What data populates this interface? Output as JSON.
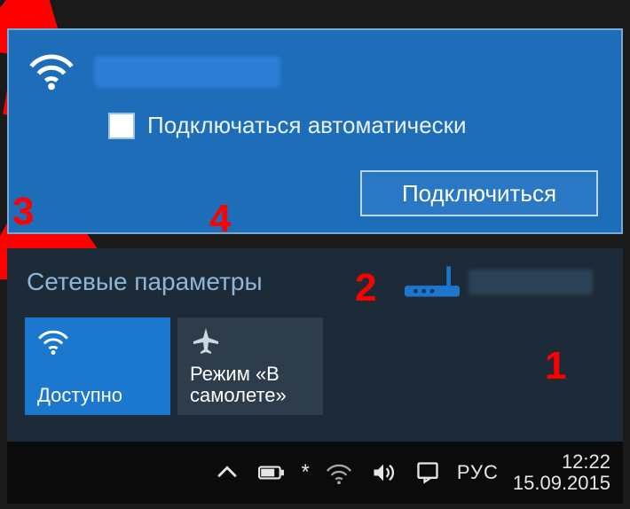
{
  "top_panel": {
    "ssid": "(blurred)",
    "auto_connect_label": "Подключаться автоматически",
    "connect_button": "Подключиться"
  },
  "bottom_panel": {
    "settings_title": "Сетевые параметры",
    "tiles": {
      "wifi_label": "Доступно",
      "airplane_label": "Режим «В самолете»"
    }
  },
  "taskbar": {
    "language": "РУС",
    "time": "12:22",
    "date": "15.09.2015"
  },
  "annotations": {
    "num1": "1",
    "num2": "2",
    "num3": "3",
    "num4": "4"
  },
  "icons": {
    "wifi": "wifi-icon",
    "airplane": "airplane-icon",
    "router": "router-icon",
    "chevron_up": "chevron-up-icon",
    "battery": "battery-icon",
    "speaker": "speaker-icon",
    "action_center": "action-center-icon"
  }
}
